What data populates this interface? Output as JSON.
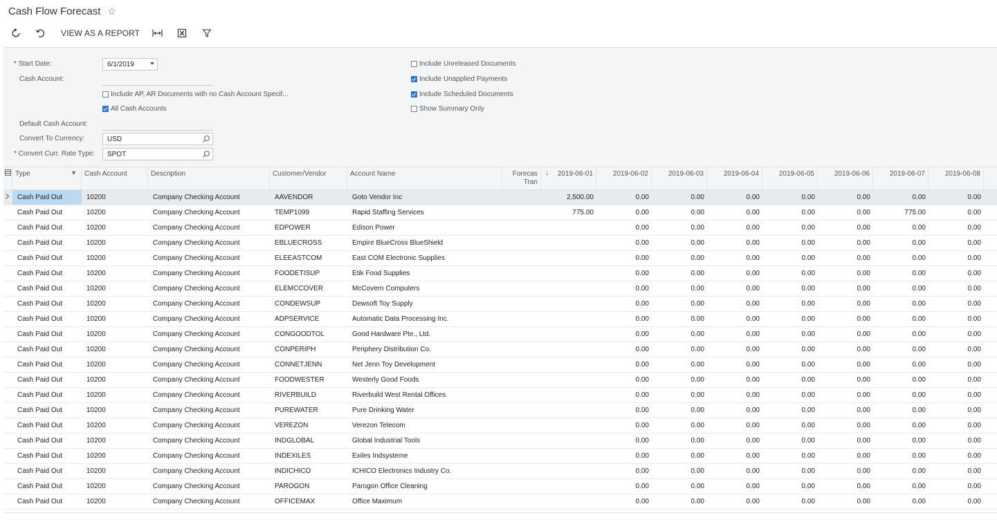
{
  "page": {
    "title": "Cash Flow Forecast"
  },
  "toolbar": {
    "view_report_label": "VIEW AS A REPORT"
  },
  "form": {
    "start_date": {
      "label": "Start Date:",
      "value": "6/1/2019"
    },
    "cash_account": {
      "label": "Cash Account:"
    },
    "include_no_cash_account": {
      "label": "Include AP, AR Documents with no Cash Account Specif...",
      "checked": false
    },
    "all_cash_accounts": {
      "label": "All Cash Accounts",
      "checked": true
    },
    "default_cash_account": {
      "label": "Default Cash Account:"
    },
    "convert_currency": {
      "label": "Convert To Currency:",
      "value": "USD"
    },
    "rate_type": {
      "label": "Convert Curr. Rate Type:",
      "value": "SPOT"
    },
    "include_unreleased": {
      "label": "Include Unreleased Documents",
      "checked": false
    },
    "include_unapplied": {
      "label": "Include Unapplied Payments",
      "checked": true
    },
    "include_scheduled": {
      "label": "Include Scheduled Documents",
      "checked": true
    },
    "show_summary": {
      "label": "Show Summary Only",
      "checked": false
    },
    "required_mark": "*"
  },
  "grid": {
    "columns": {
      "type": "Type",
      "cash_account": "Cash Account",
      "description": "Description",
      "customer_vendor": "Customer/Vendor",
      "account_name": "Account Name",
      "forecast_tran_1": "Forecas",
      "forecast_tran_2": "Tran",
      "sort_arrow": "↓",
      "dates": [
        "2019-06-01",
        "2019-06-02",
        "2019-06-03",
        "2019-06-04",
        "2019-06-05",
        "2019-06-06",
        "2019-06-07",
        "2019-06-08"
      ]
    },
    "rows": [
      {
        "type": "Cash Paid Out",
        "cash_account": "10200",
        "description": "Company Checking Account",
        "customer_vendor": "AAVENDOR",
        "account_name": "Goto Vendor Inc",
        "values": [
          "2,500.00",
          "0.00",
          "0.00",
          "0.00",
          "0.00",
          "0.00",
          "0.00",
          "0.00"
        ]
      },
      {
        "type": "Cash Paid Out",
        "cash_account": "10200",
        "description": "Company Checking Account",
        "customer_vendor": "TEMP1099",
        "account_name": "Rapid Staffing Services",
        "values": [
          "775.00",
          "0.00",
          "0.00",
          "0.00",
          "0.00",
          "0.00",
          "775.00",
          "0.00"
        ]
      },
      {
        "type": "Cash Paid Out",
        "cash_account": "10200",
        "description": "Company Checking Account",
        "customer_vendor": "EDPOWER",
        "account_name": "Edison Power",
        "values": [
          "",
          "0.00",
          "0.00",
          "0.00",
          "0.00",
          "0.00",
          "0.00",
          "0.00"
        ]
      },
      {
        "type": "Cash Paid Out",
        "cash_account": "10200",
        "description": "Company Checking Account",
        "customer_vendor": "EBLUECROSS",
        "account_name": "Empire BlueCross BlueShield",
        "values": [
          "",
          "0.00",
          "0.00",
          "0.00",
          "0.00",
          "0.00",
          "0.00",
          "0.00"
        ]
      },
      {
        "type": "Cash Paid Out",
        "cash_account": "10200",
        "description": "Company Checking Account",
        "customer_vendor": "ELEEASTCOM",
        "account_name": "East COM Electronic Supplies",
        "values": [
          "",
          "0.00",
          "0.00",
          "0.00",
          "0.00",
          "0.00",
          "0.00",
          "0.00"
        ]
      },
      {
        "type": "Cash Paid Out",
        "cash_account": "10200",
        "description": "Company Checking Account",
        "customer_vendor": "FOODETISUP",
        "account_name": "Etik Food Supplies",
        "values": [
          "",
          "0.00",
          "0.00",
          "0.00",
          "0.00",
          "0.00",
          "0.00",
          "0.00"
        ]
      },
      {
        "type": "Cash Paid Out",
        "cash_account": "10200",
        "description": "Company Checking Account",
        "customer_vendor": "ELEMCCOVER",
        "account_name": "McCovern Computers",
        "values": [
          "",
          "0.00",
          "0.00",
          "0.00",
          "0.00",
          "0.00",
          "0.00",
          "0.00"
        ]
      },
      {
        "type": "Cash Paid Out",
        "cash_account": "10200",
        "description": "Company Checking Account",
        "customer_vendor": "CONDEWSUP",
        "account_name": "Dewsoft Toy Supply",
        "values": [
          "",
          "0.00",
          "0.00",
          "0.00",
          "0.00",
          "0.00",
          "0.00",
          "0.00"
        ]
      },
      {
        "type": "Cash Paid Out",
        "cash_account": "10200",
        "description": "Company Checking Account",
        "customer_vendor": "ADPSERVICE",
        "account_name": "Automatic Data Processing Inc.",
        "values": [
          "",
          "0.00",
          "0.00",
          "0.00",
          "0.00",
          "0.00",
          "0.00",
          "0.00"
        ]
      },
      {
        "type": "Cash Paid Out",
        "cash_account": "10200",
        "description": "Company Checking Account",
        "customer_vendor": "CONGOODTOL",
        "account_name": "Good Hardware Pte., Ltd.",
        "values": [
          "",
          "0.00",
          "0.00",
          "0.00",
          "0.00",
          "0.00",
          "0.00",
          "0.00"
        ]
      },
      {
        "type": "Cash Paid Out",
        "cash_account": "10200",
        "description": "Company Checking Account",
        "customer_vendor": "CONPERIPH",
        "account_name": "Periphery Distribution Co.",
        "values": [
          "",
          "0.00",
          "0.00",
          "0.00",
          "0.00",
          "0.00",
          "0.00",
          "0.00"
        ]
      },
      {
        "type": "Cash Paid Out",
        "cash_account": "10200",
        "description": "Company Checking Account",
        "customer_vendor": "CONNETJENN",
        "account_name": "Net Jenn Toy Development",
        "values": [
          "",
          "0.00",
          "0.00",
          "0.00",
          "0.00",
          "0.00",
          "0.00",
          "0.00"
        ]
      },
      {
        "type": "Cash Paid Out",
        "cash_account": "10200",
        "description": "Company Checking Account",
        "customer_vendor": "FOODWESTER",
        "account_name": "Westerly Good Foods",
        "values": [
          "",
          "0.00",
          "0.00",
          "0.00",
          "0.00",
          "0.00",
          "0.00",
          "0.00"
        ]
      },
      {
        "type": "Cash Paid Out",
        "cash_account": "10200",
        "description": "Company Checking Account",
        "customer_vendor": "RIVERBUILD",
        "account_name": "Riverbuild West Rental Offices",
        "values": [
          "",
          "0.00",
          "0.00",
          "0.00",
          "0.00",
          "0.00",
          "0.00",
          "0.00"
        ]
      },
      {
        "type": "Cash Paid Out",
        "cash_account": "10200",
        "description": "Company Checking Account",
        "customer_vendor": "PUREWATER",
        "account_name": "Pure Drinking Water",
        "values": [
          "",
          "0.00",
          "0.00",
          "0.00",
          "0.00",
          "0.00",
          "0.00",
          "0.00"
        ]
      },
      {
        "type": "Cash Paid Out",
        "cash_account": "10200",
        "description": "Company Checking Account",
        "customer_vendor": "VEREZON",
        "account_name": "Verezon Telecom",
        "values": [
          "",
          "0.00",
          "0.00",
          "0.00",
          "0.00",
          "0.00",
          "0.00",
          "0.00"
        ]
      },
      {
        "type": "Cash Paid Out",
        "cash_account": "10200",
        "description": "Company Checking Account",
        "customer_vendor": "INDGLOBAL",
        "account_name": "Global Industrial Tools",
        "values": [
          "",
          "0.00",
          "0.00",
          "0.00",
          "0.00",
          "0.00",
          "0.00",
          "0.00"
        ]
      },
      {
        "type": "Cash Paid Out",
        "cash_account": "10200",
        "description": "Company Checking Account",
        "customer_vendor": "INDEXILES",
        "account_name": "Exiles Indsysteme",
        "values": [
          "",
          "0.00",
          "0.00",
          "0.00",
          "0.00",
          "0.00",
          "0.00",
          "0.00"
        ]
      },
      {
        "type": "Cash Paid Out",
        "cash_account": "10200",
        "description": "Company Checking Account",
        "customer_vendor": "INDICHICO",
        "account_name": "ICHICO Electronics Industry Co.",
        "values": [
          "",
          "0.00",
          "0.00",
          "0.00",
          "0.00",
          "0.00",
          "0.00",
          "0.00"
        ]
      },
      {
        "type": "Cash Paid Out",
        "cash_account": "10200",
        "description": "Company Checking Account",
        "customer_vendor": "PAROGON",
        "account_name": "Parogon Office Cleaning",
        "values": [
          "",
          "0.00",
          "0.00",
          "0.00",
          "0.00",
          "0.00",
          "0.00",
          "0.00"
        ]
      },
      {
        "type": "Cash Paid Out",
        "cash_account": "10200",
        "description": "Company Checking Account",
        "customer_vendor": "OFFICEMAX",
        "account_name": "Office Maximum",
        "values": [
          "",
          "0.00",
          "0.00",
          "0.00",
          "0.00",
          "0.00",
          "0.00",
          "0.00"
        ]
      }
    ]
  }
}
